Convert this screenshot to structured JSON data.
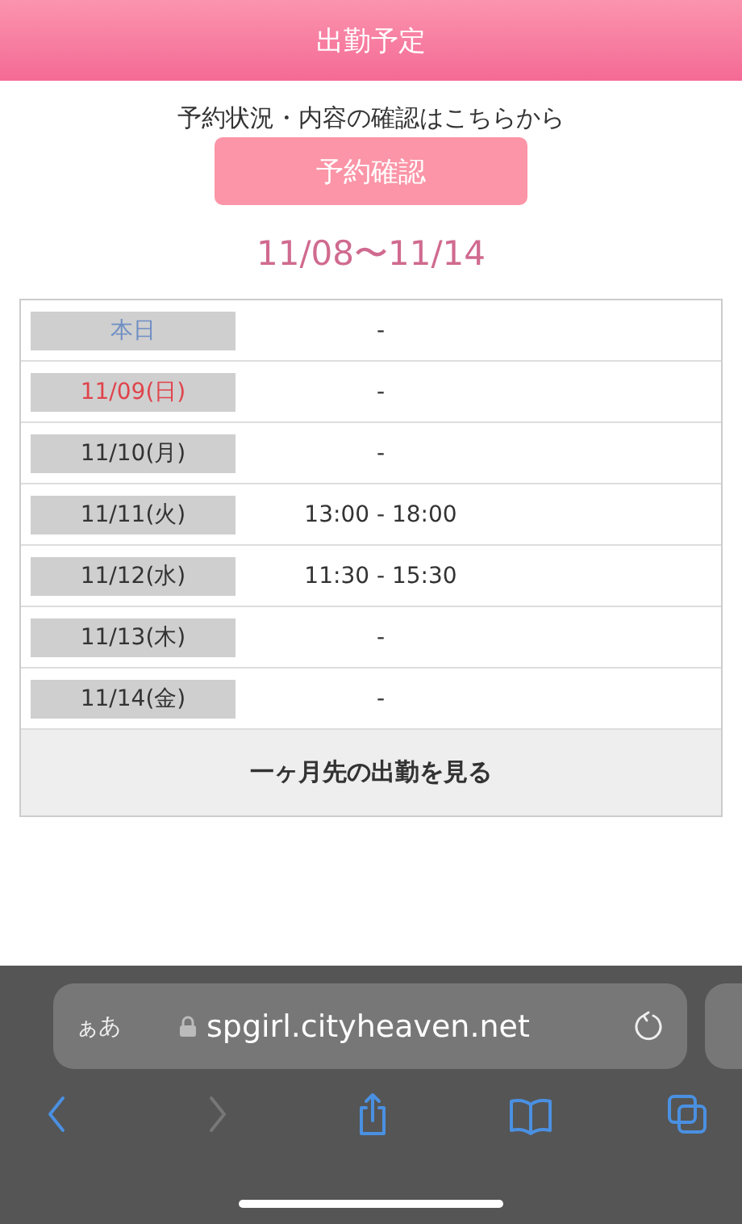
{
  "header": {
    "title": "出勤予定"
  },
  "reservation": {
    "note": "予約状況・内容の確認はこちらから",
    "button": "予約確認"
  },
  "range": "11/08〜11/14",
  "schedule": [
    {
      "date": "本日",
      "kind": "today",
      "hours": "-"
    },
    {
      "date": "11/09(日)",
      "kind": "sunday",
      "hours": "-"
    },
    {
      "date": "11/10(月)",
      "kind": "weekday",
      "hours": "-"
    },
    {
      "date": "11/11(火)",
      "kind": "weekday",
      "hours": "13:00 - 18:00"
    },
    {
      "date": "11/12(水)",
      "kind": "weekday",
      "hours": "11:30 - 15:30"
    },
    {
      "date": "11/13(木)",
      "kind": "weekday",
      "hours": "-"
    },
    {
      "date": "11/14(金)",
      "kind": "weekday",
      "hours": "-"
    }
  ],
  "more_button": "一ヶ月先の出勤を見る",
  "browser": {
    "text_size": "ぁあ",
    "url": "spgirl.cityheaven.net",
    "toolbar": [
      {
        "kind": "back",
        "disabled": false
      },
      {
        "kind": "forward",
        "disabled": true
      },
      {
        "kind": "share",
        "disabled": false
      },
      {
        "kind": "bookmarks",
        "disabled": false
      },
      {
        "kind": "tabs",
        "disabled": false
      }
    ]
  }
}
